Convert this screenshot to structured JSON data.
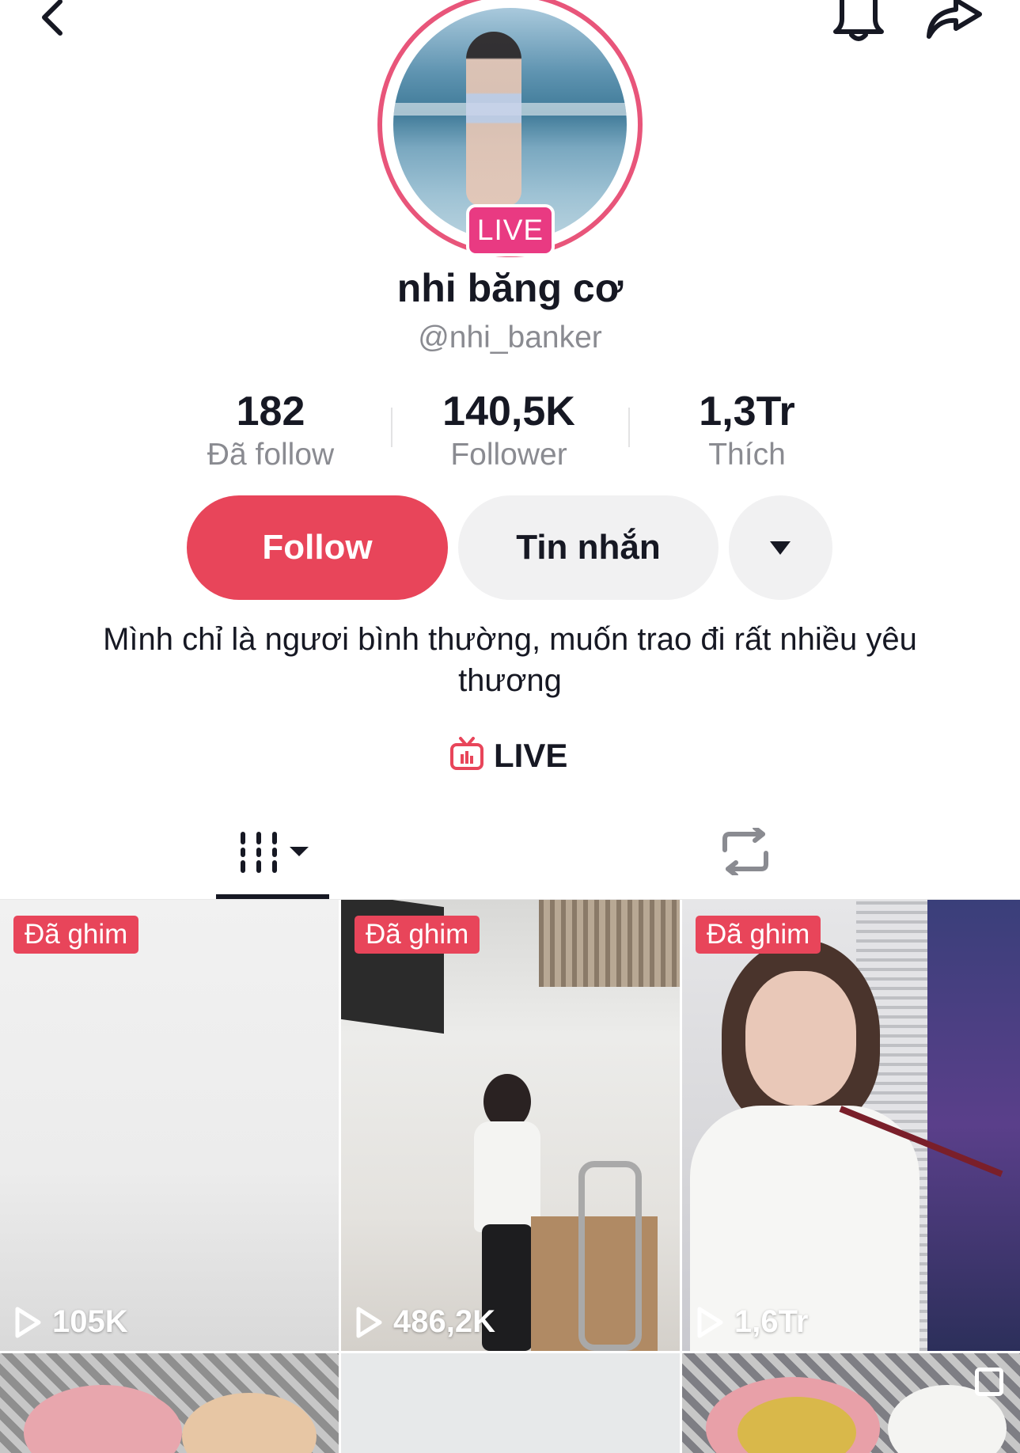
{
  "profile": {
    "name": "nhi băng cơ",
    "handle": "@nhi_banker",
    "live_badge": "LIVE",
    "bio": "Mình chỉ là ngươi bình thường, muốn trao đi rất nhiều yêu thương"
  },
  "stats": [
    {
      "value": "182",
      "label": "Đã follow"
    },
    {
      "value": "140,5K",
      "label": "Follower"
    },
    {
      "value": "1,3Tr",
      "label": "Thích"
    }
  ],
  "actions": {
    "follow": "Follow",
    "message": "Tin nhắn"
  },
  "live_link": "LIVE",
  "videos": [
    {
      "pinned": "Đã ghim",
      "views": "105K"
    },
    {
      "pinned": "Đã ghim",
      "views": "486,2K"
    },
    {
      "pinned": "Đã ghim",
      "views": "1,6Tr"
    }
  ],
  "icons": {
    "back": "chevron-left-icon",
    "notification": "bell-icon",
    "share": "share-arrow-icon",
    "videos_tab": "grid-icon",
    "reposts_tab": "repost-icon",
    "live": "tv-icon",
    "play": "play-icon"
  },
  "colors": {
    "follow_button": "#e8455a",
    "pinned_badge": "#e8455a",
    "live_badge": "#e93a82",
    "avatar_ring": "#e8557a"
  }
}
